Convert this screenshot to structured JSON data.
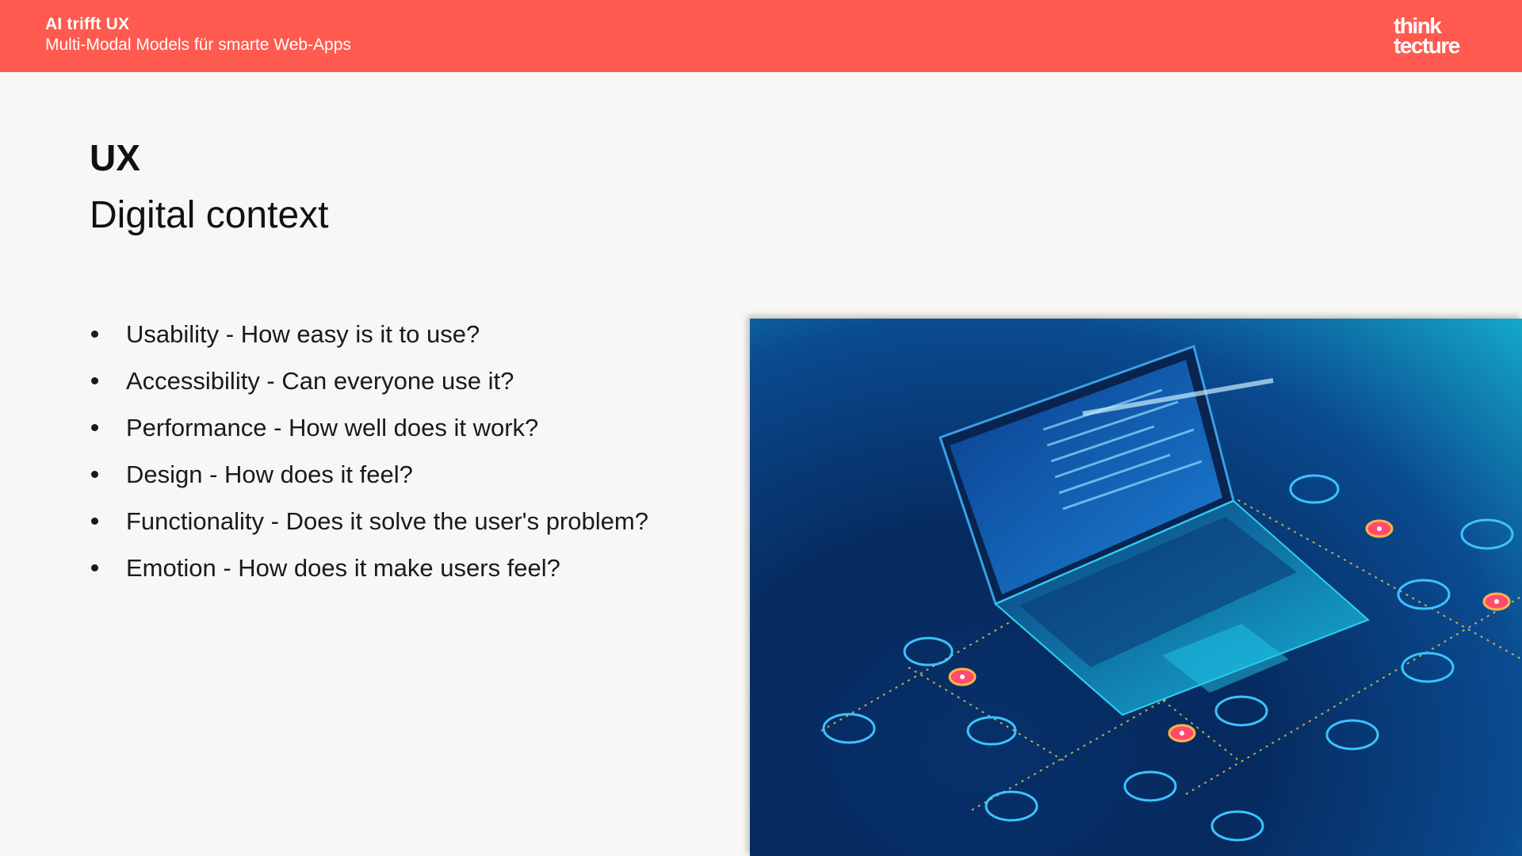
{
  "header": {
    "title": "AI trifft UX",
    "subtitle": "Multi-Modal Models für smarte Web-Apps",
    "logo_line1": "think",
    "logo_line2": "tecture",
    "background_color": "#ff5a4f"
  },
  "slide": {
    "title": "UX",
    "subtitle": "Digital context",
    "bullets": [
      "Usability - How easy is it to use?",
      "Accessibility - Can everyone use it?",
      "Performance - How well does it work?",
      "Design - How does it feel?",
      "Functionality - Does it solve the user's problem?",
      "Emotion - How does it make users feel?"
    ]
  },
  "image": {
    "icon": "laptop-network-illustration-icon"
  }
}
